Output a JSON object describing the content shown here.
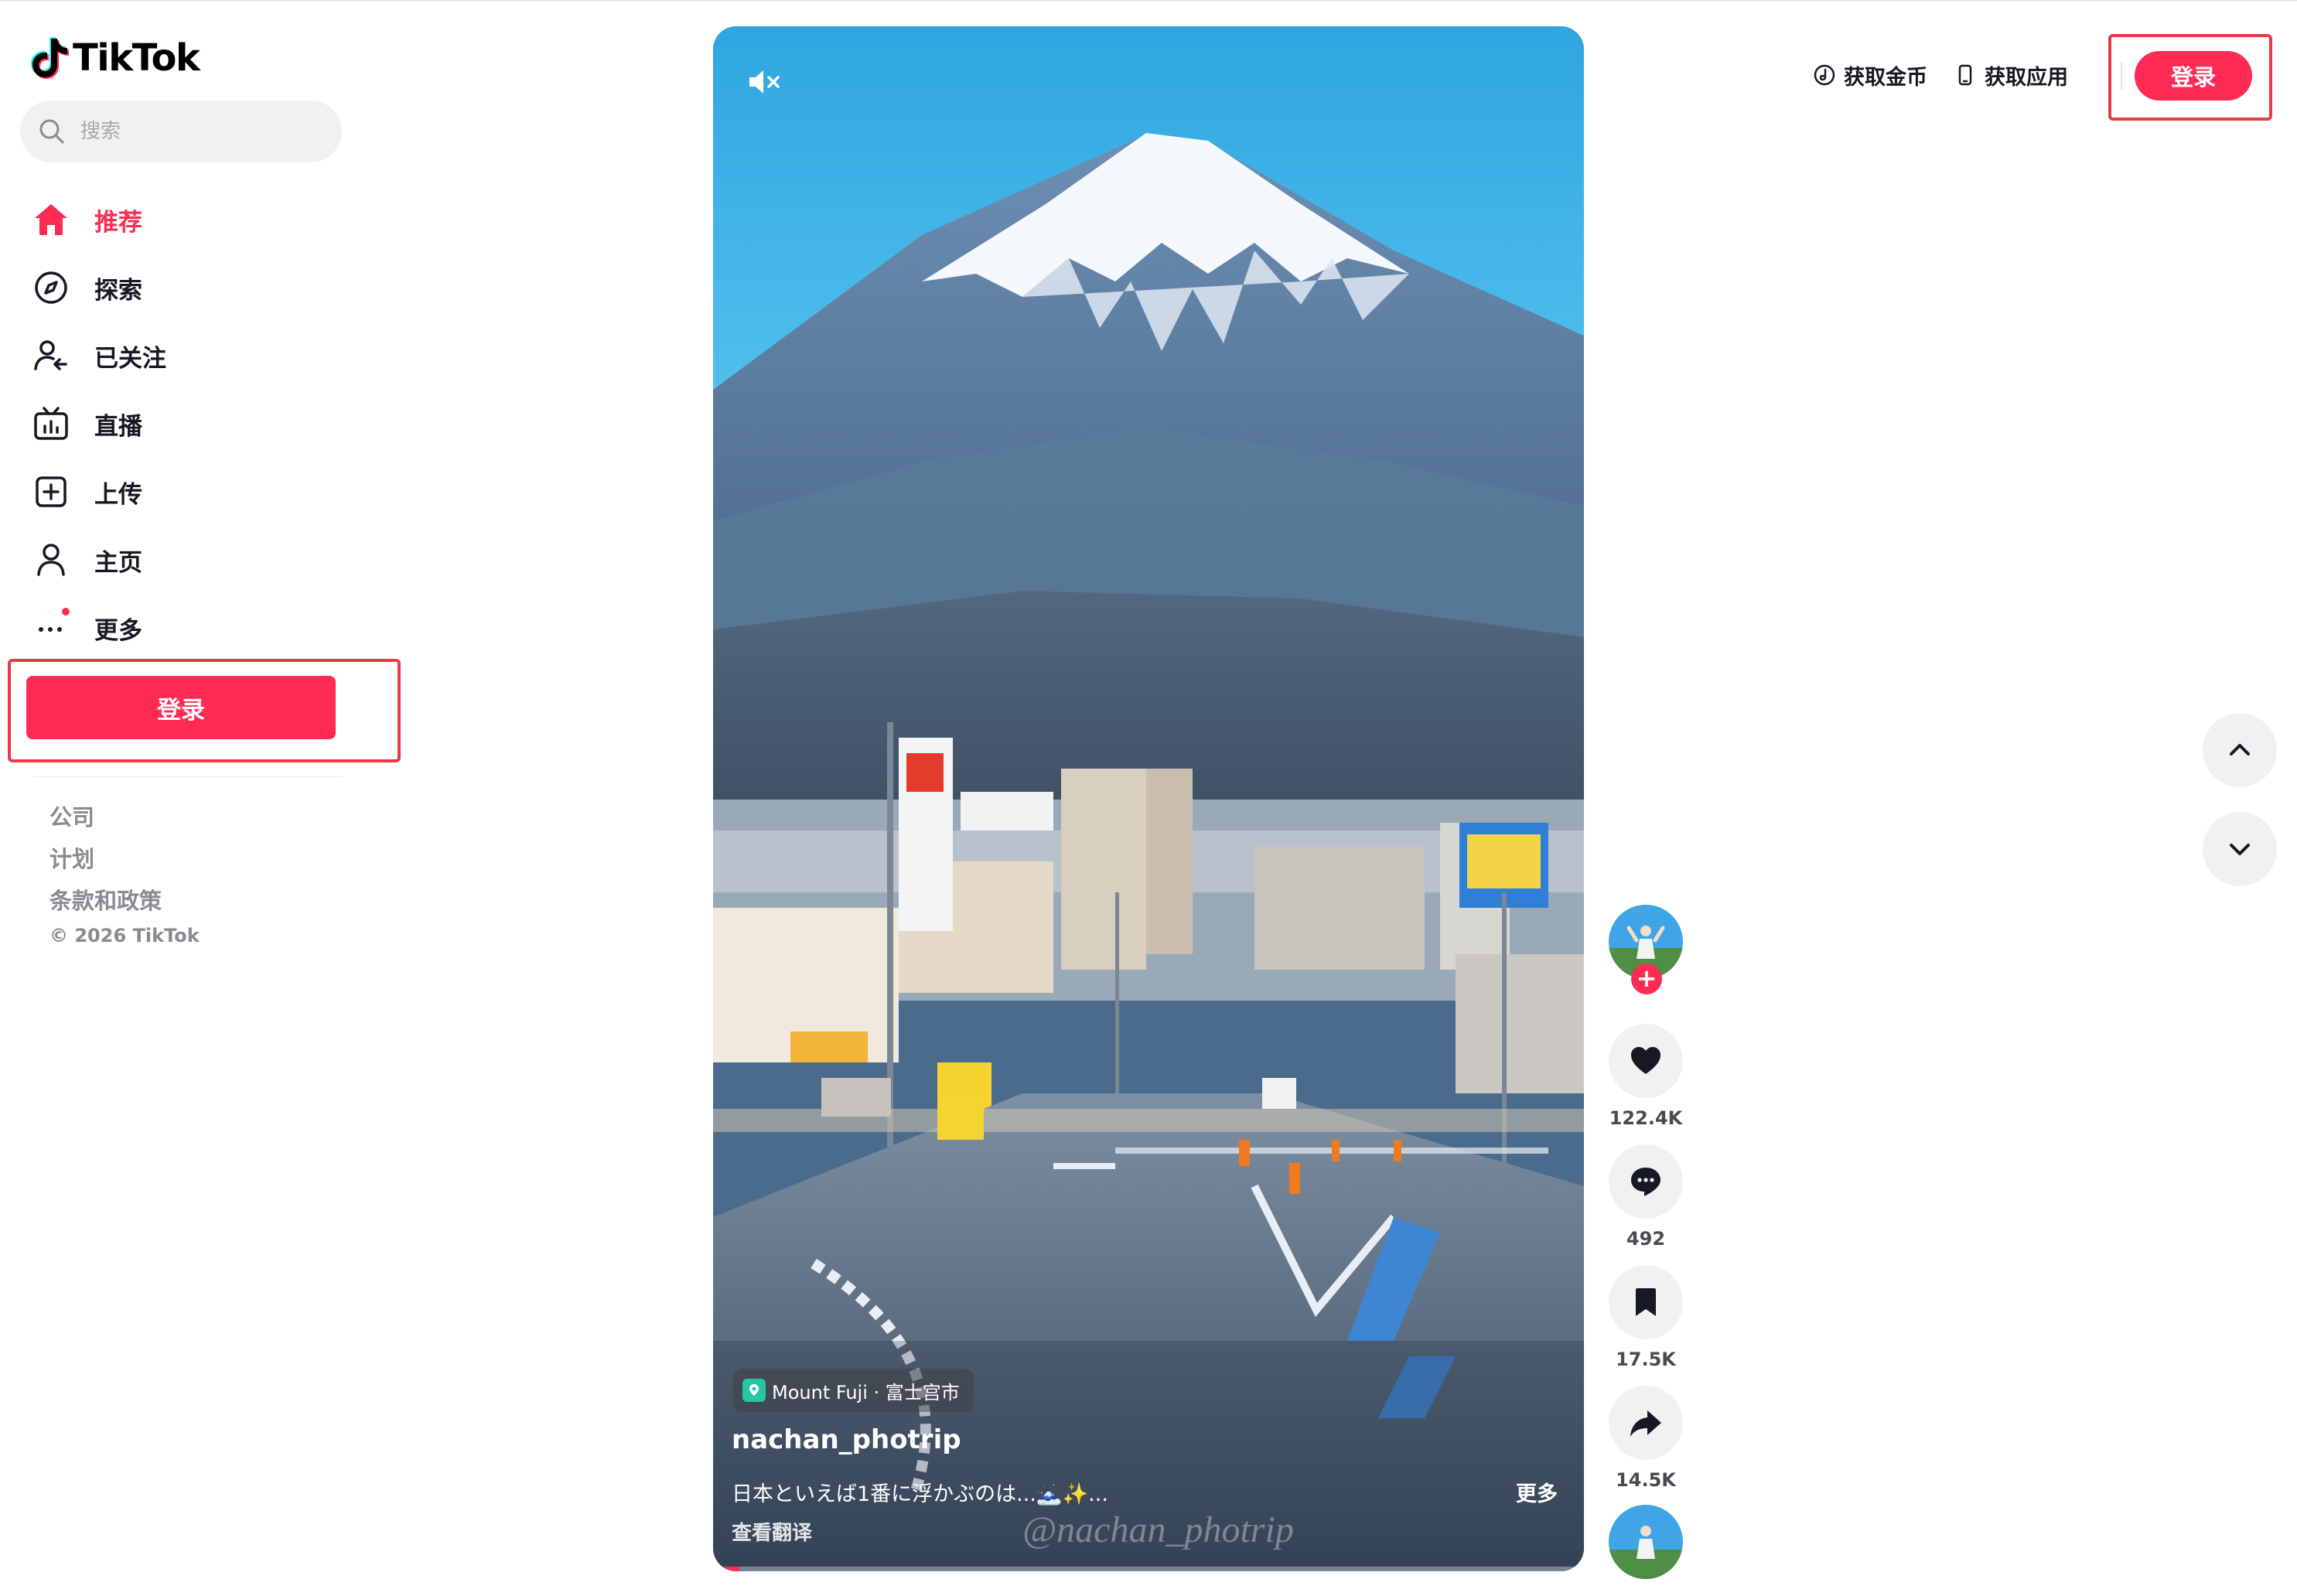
{
  "app": {
    "name": "TikTok"
  },
  "search": {
    "placeholder": "搜索"
  },
  "nav": {
    "items": [
      {
        "label": "推荐",
        "icon": "home-icon",
        "active": true
      },
      {
        "label": "探索",
        "icon": "compass-icon"
      },
      {
        "label": "已关注",
        "icon": "following-icon"
      },
      {
        "label": "直播",
        "icon": "live-tv-icon"
      },
      {
        "label": "上传",
        "icon": "upload-plus-icon"
      },
      {
        "label": "主页",
        "icon": "profile-icon"
      },
      {
        "label": "更多",
        "icon": "more-dots-icon",
        "has_notification_dot": true
      }
    ]
  },
  "sidebar": {
    "login_label": "登录"
  },
  "footer": {
    "links": [
      "公司",
      "计划",
      "条款和政策"
    ],
    "copyright": "© 2026 TikTok"
  },
  "topbar": {
    "get_coins": "获取金币",
    "get_app": "获取应用",
    "login_label": "登录"
  },
  "video": {
    "location": "Mount Fuji · 富士宫市",
    "author": "nachan_photrip",
    "description": "日本といえば1番に浮かぶのは...🗻✨...",
    "more_label": "更多",
    "translate_label": "查看翻译",
    "watermark": "@nachan_photrip",
    "muted": true,
    "progress": 0.03
  },
  "actions": {
    "likes": "122.4K",
    "comments": "492",
    "saves": "17.5K",
    "shares": "14.5K"
  },
  "colors": {
    "accent": "#fe2c55",
    "highlight_box": "#e8394a",
    "text": "#161823",
    "muted_text": "#8a8b91"
  }
}
